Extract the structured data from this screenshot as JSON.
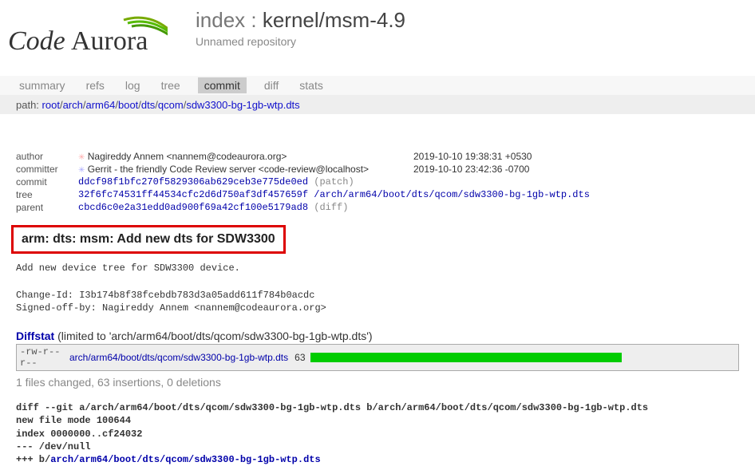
{
  "header": {
    "index_label": "index :",
    "repo": "kernel/msm-4.9",
    "subtitle": "Unnamed repository"
  },
  "tabs": {
    "items": [
      "summary",
      "refs",
      "log",
      "tree",
      "commit",
      "diff",
      "stats"
    ],
    "active": "commit"
  },
  "path": {
    "label": "path:",
    "segments": [
      "root",
      "arch",
      "arm64",
      "boot",
      "dts",
      "qcom",
      "sdw3300-bg-1gb-wtp.dts"
    ]
  },
  "commit": {
    "author": {
      "name": "Nagireddy Annem <nannem@codeaurora.org>",
      "date": "2019-10-10 19:38:31 +0530"
    },
    "committer": {
      "name": "Gerrit - the friendly Code Review server <code-review@localhost>",
      "date": "2019-10-10 23:42:36 -0700"
    },
    "hash": "ddcf98f1bfc270f5829306ab629ceb3e775de0ed",
    "patch_label": "(patch)",
    "tree_hash": "32f6fc74531ff44534cfc2d6d750af3df457659f",
    "tree_path": "/arch/arm64/boot/dts/qcom/sdw3300-bg-1gb-wtp.dts",
    "parent_hash": "cbcd6c0e2a31edd0ad900f69a42cf100e5179ad8",
    "diff_label": "(diff)",
    "labels": {
      "author": "author",
      "committer": "committer",
      "commit": "commit",
      "tree": "tree",
      "parent": "parent"
    }
  },
  "message": {
    "title": "arm: dts: msm: Add new dts for SDW3300",
    "body": "Add new device tree for SDW3300 device.\n\nChange-Id: I3b174b8f38fcebdb783d3a05add611f784b0acdc\nSigned-off-by: Nagireddy Annem <nannem@codeaurora.org>"
  },
  "diffstat": {
    "link": "Diffstat",
    "limited": " (limited to 'arch/arm64/boot/dts/qcom/sdw3300-bg-1gb-wtp.dts')",
    "row": {
      "mode": "-rw-r--r--",
      "file": "arch/arm64/boot/dts/qcom/sdw3300-bg-1gb-wtp.dts",
      "count": "63"
    },
    "summary": "1 files changed, 63 insertions, 0 deletions"
  },
  "diff": {
    "header": "diff --git a/arch/arm64/boot/dts/qcom/sdw3300-bg-1gb-wtp.dts b/arch/arm64/boot/dts/qcom/sdw3300-bg-1gb-wtp.dts",
    "newfile": "new file mode 100644",
    "index": "index 0000000..cf24032",
    "minus": "--- /dev/null",
    "plus_prefix": "+++ b/",
    "plus_file": "arch/arm64/boot/dts/qcom/sdw3300-bg-1gb-wtp.dts"
  }
}
